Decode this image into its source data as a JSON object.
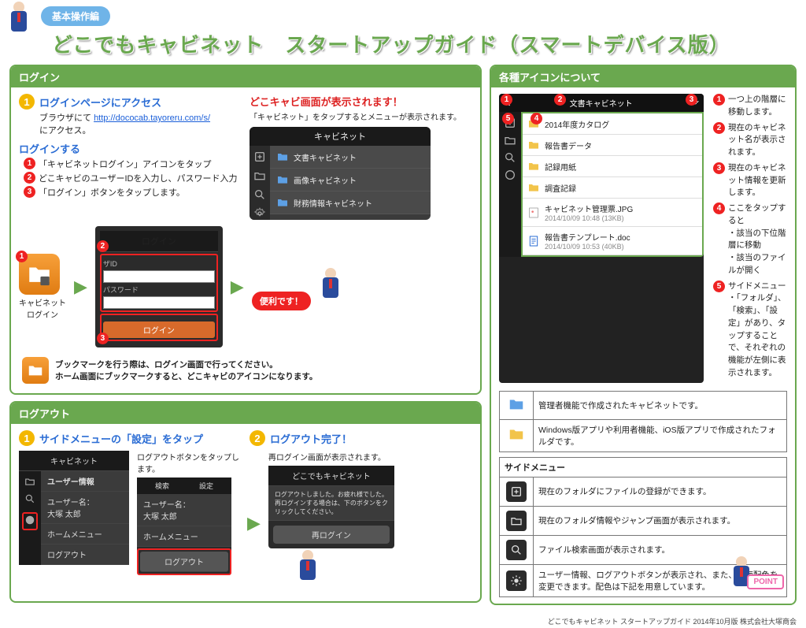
{
  "top": {
    "tag": "基本操作編",
    "title": "どこでもキャビネット　スタートアップガイド（スマートデバイス版）"
  },
  "login": {
    "header": "ログイン",
    "step1": {
      "title": "ログインページにアクセス",
      "body_a": "ブラウザにて ",
      "url": "http://dococab.tayoreru.com/s/",
      "body_b": " にアクセス。"
    },
    "callout": "どこキャビ画面が表示されます！",
    "callout_sub": "「キャビネット」をタップするとメニューが表示されます。",
    "step2": {
      "title": "ログインする",
      "s1": "「キャビネットログイン」アイコンをタップ",
      "s2": "どこキャビのユーザーIDを入力し、パスワード入力",
      "s3": "「ログイン」ボタンをタップします。"
    },
    "dev": {
      "title": "キャビネット",
      "items": [
        "文書キャビネット",
        "画像キャビネット",
        "財務情報キャビネット"
      ],
      "side": [
        "登録",
        "フォルダ",
        "検索",
        "設定"
      ]
    },
    "loginshot": {
      "title": "ログイン",
      "id_lbl": "ザID",
      "pw_lbl": "パスワード",
      "btn": "ログイン"
    },
    "cabicon_lbl1": "キャビネット",
    "cabicon_lbl2": "ログイン",
    "bubble": "便利です！",
    "note1": "ブックマークを行う際は、ログイン画面で行ってください。",
    "note2": "ホーム画面にブックマークすると、どこキャビのアイコンになります。"
  },
  "logout": {
    "header": "ログアウト",
    "step1": "サイドメニューの「設定」をタップ",
    "step2": "ログアウト完了！",
    "txt1": "ログアウトボタンをタップします。",
    "txt2": "再ログイン画面が表示されます。",
    "s1": {
      "title": "キャビネット",
      "user_hd": "ユーザー情報",
      "user_lbl": "ユーザー名：",
      "user_val": "大塚 太郎",
      "home": "ホームメニュー",
      "logout": "ログアウト"
    },
    "s2": {
      "search": "検索",
      "settings": "設定",
      "user_lbl": "ユーザー名：",
      "user_val": "大塚 太郎",
      "home": "ホームメニュー",
      "logout": "ログアウト"
    },
    "dlg": {
      "title": "どこでもキャビネット",
      "body": "ログアウトしました。お疲れ様でした。\n再ログインする場合は、下のボタンをクリックしてください。",
      "btn": "再ログイン"
    }
  },
  "icons": {
    "header": "各種アイコンについて",
    "shot": {
      "title": "文書キャビネット",
      "items": [
        {
          "name": "2014年度カタログ",
          "type": "folder"
        },
        {
          "name": "報告書データ",
          "type": "folder"
        },
        {
          "name": "記録用紙",
          "type": "folder"
        },
        {
          "name": "調査記録",
          "type": "folder"
        },
        {
          "name": "キャビネット管理票.JPG",
          "sub": "2014/10/09 10:48 (13KB)",
          "type": "jpg"
        },
        {
          "name": "報告書テンプレート.doc",
          "sub": "2014/10/09 10:53 (40KB)",
          "type": "doc"
        }
      ]
    },
    "ex": [
      {
        "n": "1",
        "t": "一つ上の階層に移動します。"
      },
      {
        "n": "2",
        "t": "現在のキャビネット名が表示されます。"
      },
      {
        "n": "3",
        "t": "現在のキャビネット情報を更新します。"
      },
      {
        "n": "4",
        "t": "ここをタップすると",
        "sub": [
          "・該当の下位階層に移動",
          "・該当のファイルが開く"
        ]
      },
      {
        "n": "5",
        "t": "サイドメニュー",
        "sub": [
          "・「フォルダ」、「検索」、「設定」があり、タップすることで、それぞれの機能が左側に表示されます。"
        ]
      }
    ],
    "legend": [
      {
        "t": "管理者機能で作成されたキャビネットです。"
      },
      {
        "t": "Windows版アプリや利用者機能、iOS版アプリで作成されたフォルダです。"
      }
    ],
    "sidemenu_hd": "サイドメニュー",
    "sidemenu": [
      {
        "t": "現在のフォルダにファイルの登録ができます。"
      },
      {
        "t": "現在のフォルダ情報やジャンプ画面が表示されます。"
      },
      {
        "t": "ファイル検索画面が表示されます。"
      },
      {
        "t": "ユーザー情報、ログアウトボタンが表示され、また、画面配色を変更できます。配色は下記を用意しています。"
      }
    ]
  },
  "footer": "どこでもキャビネット スタートアップガイド 2014年10月版 株式会社大塚商会",
  "point": "POINT"
}
